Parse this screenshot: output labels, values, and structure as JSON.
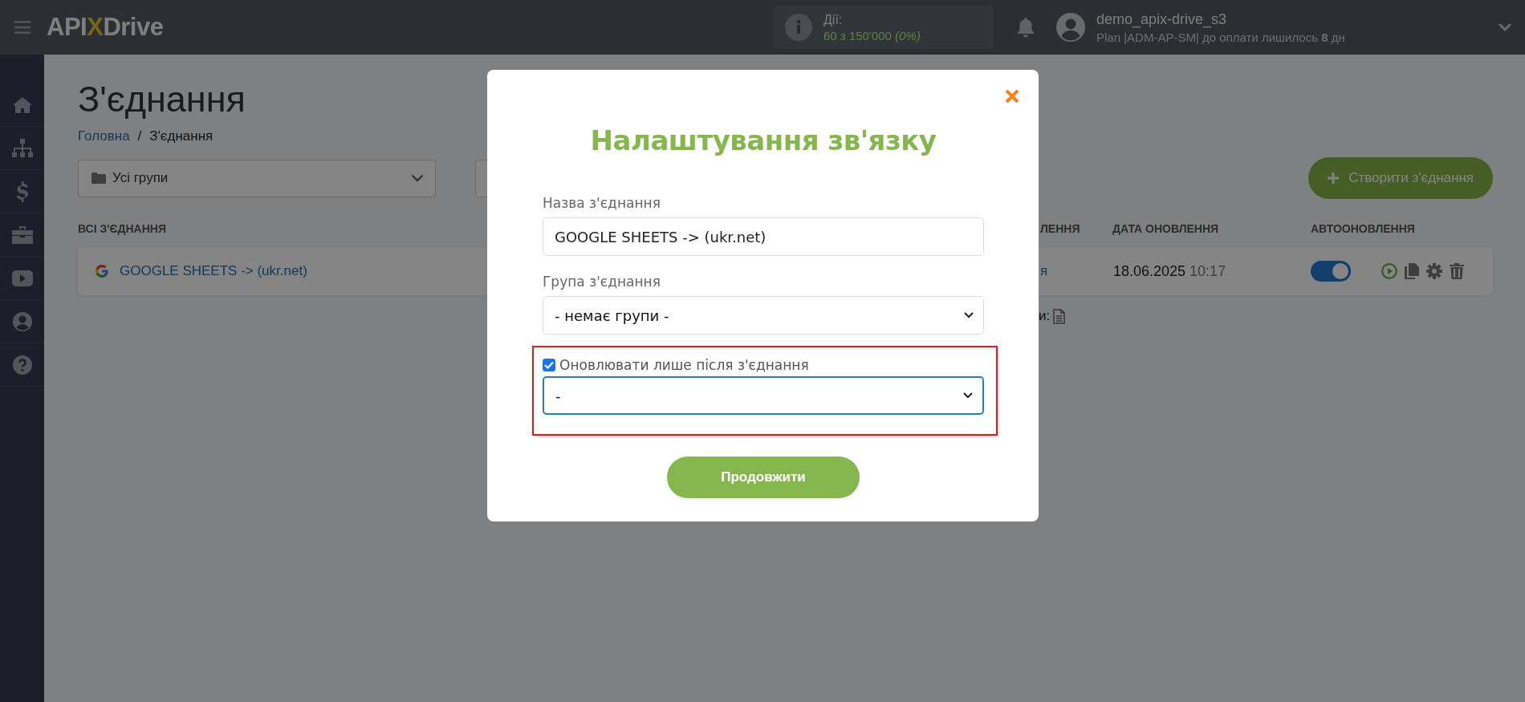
{
  "topbar": {
    "logo": [
      "API",
      "X",
      "Drive"
    ],
    "actions": {
      "label": "Дії:",
      "value": "60 з 150'000",
      "percent": "(0%)"
    },
    "user": {
      "name": "demo_apix-drive_s3",
      "plan": "Plan |ADM-AP-SM| до оплати лишилось **8** дн"
    }
  },
  "page": {
    "title": "З'єднання",
    "breadcrumb": [
      "Головна",
      "/",
      "З'єднання"
    ],
    "group_filter": "Усі групи",
    "create_button": "Створити з'єднання"
  },
  "table": {
    "columns": [
      "ВСІ З'ЄДНАННЯ",
      "ЛЕННЯ",
      "ДАТА ОНОВЛЕННЯ",
      "АВТООНОВЛЕННЯ"
    ],
    "rows": [
      {
        "name": "GOOGLE SHEETS -> (ukr.net)",
        "column_2": "я",
        "date": "18.06.2025",
        "time": "10:17",
        "auto_update": true
      }
    ]
  },
  "footer_fragment": "и:",
  "modal": {
    "title": "Налаштування зв'язку",
    "fields": [
      {
        "kind": "text",
        "label": "Назва з'єднання",
        "value": "GOOGLE SHEETS -> (ukr.net)",
        "focused": false,
        "highlighted": false
      },
      {
        "kind": "select",
        "label": "Група з'єднання",
        "value": "- немає групи -",
        "focused": false,
        "highlighted": false
      },
      {
        "kind": "checkbox-select",
        "label": "Оновлювати лише після з'єднання",
        "checked": true,
        "value": "-",
        "focused": true,
        "highlighted": true
      }
    ],
    "submit": "Продовжити"
  }
}
